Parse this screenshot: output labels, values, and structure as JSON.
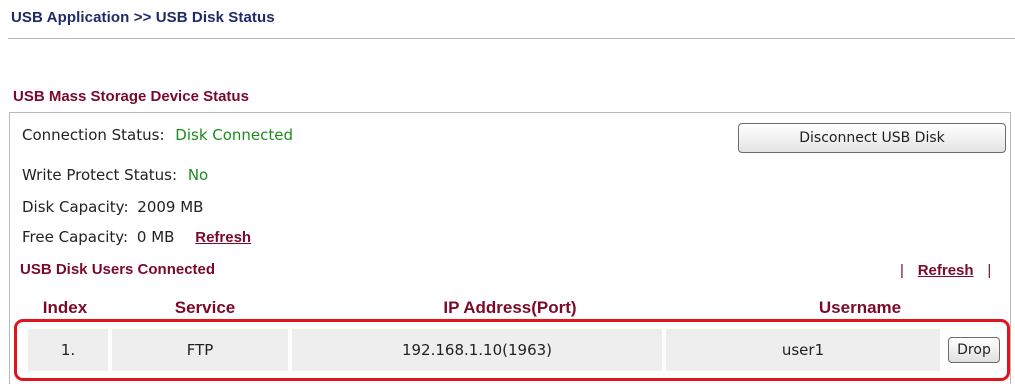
{
  "header": {
    "title": "USB Application >> USB Disk Status"
  },
  "section": {
    "title": "USB Mass Storage Device Status"
  },
  "status": {
    "connection_label": "Connection Status:",
    "connection_value": "Disk Connected",
    "write_protect_label": "Write Protect Status:",
    "write_protect_value": "No",
    "disk_capacity_label": "Disk Capacity:",
    "disk_capacity_value": "2009 MB",
    "free_capacity_label": "Free Capacity:",
    "free_capacity_value": "0 MB",
    "refresh_label": "Refresh"
  },
  "actions": {
    "disconnect_label": "Disconnect USB Disk"
  },
  "users": {
    "title": "USB Disk Users Connected",
    "separator": "|",
    "refresh_label": "Refresh",
    "columns": [
      "Index",
      "Service",
      "IP Address(Port)",
      "Username"
    ],
    "rows": [
      {
        "index": "1.",
        "service": "FTP",
        "ip_port": "192.168.1.10(1963)",
        "username": "user1",
        "action_label": "Drop"
      }
    ]
  },
  "colors": {
    "title_color": "#1f2a6b",
    "section_color": "#7a0a2a",
    "status_value_color": "#1e8b1e",
    "highlight_color": "#e0141e"
  }
}
